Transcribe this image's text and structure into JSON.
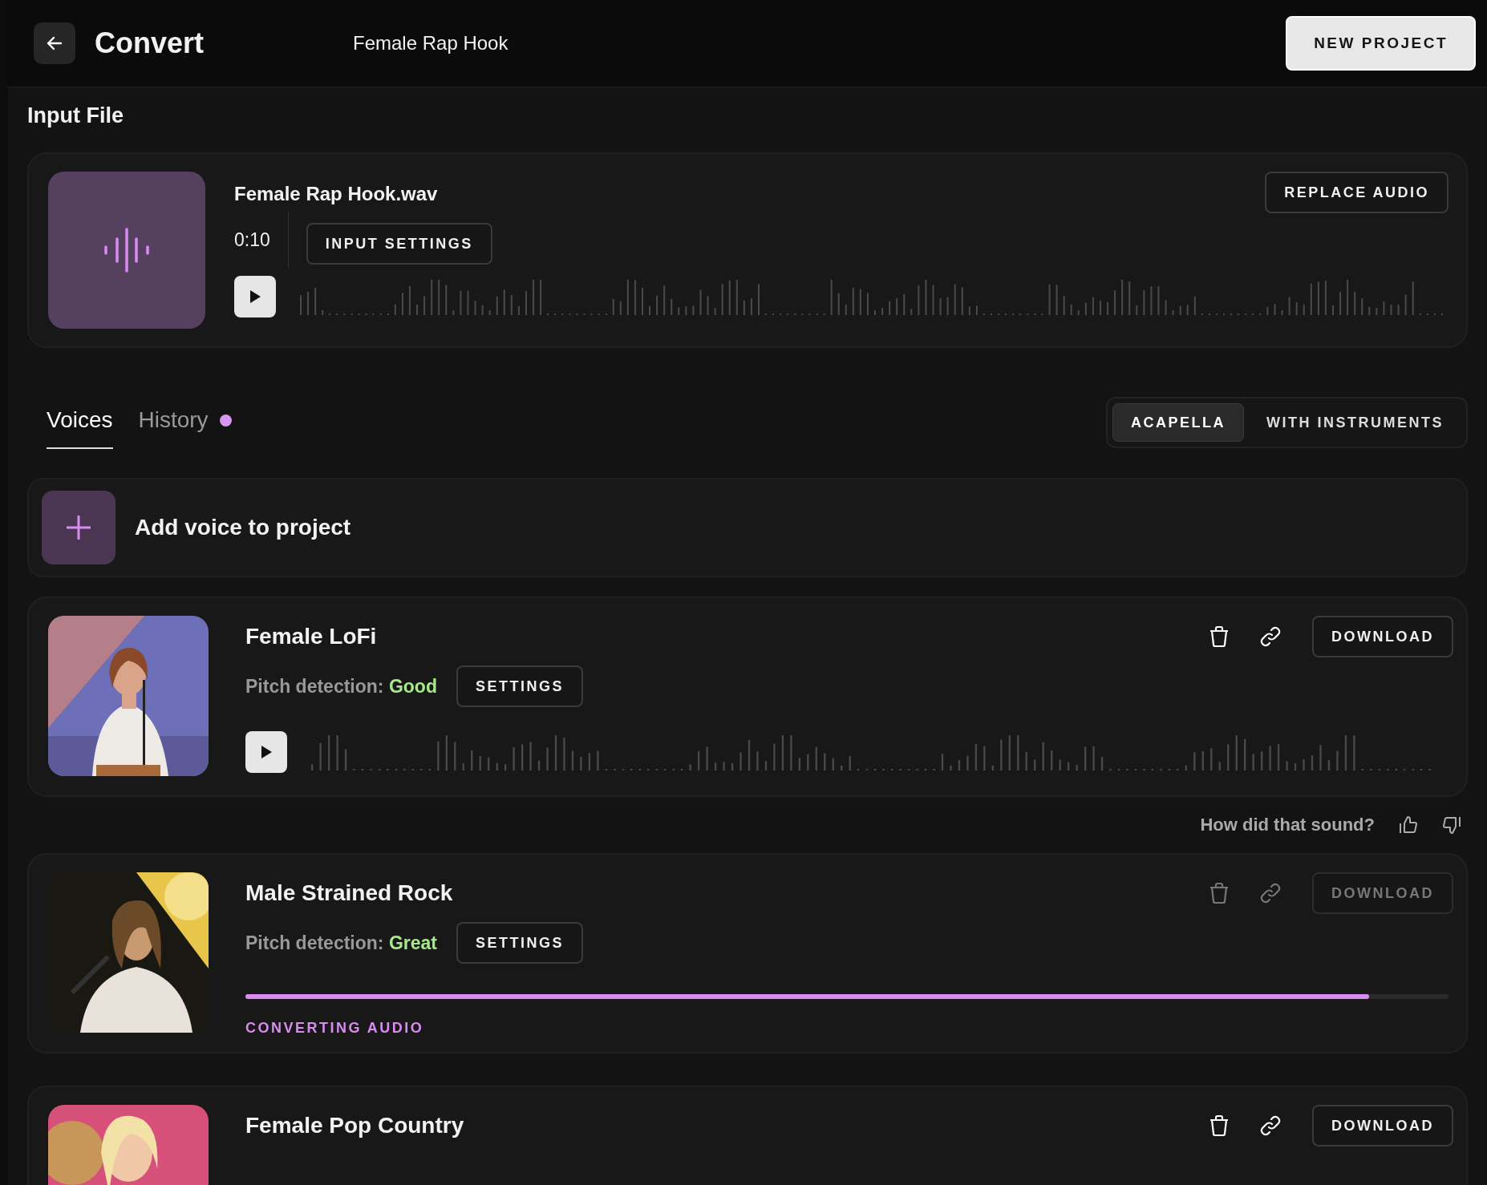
{
  "header": {
    "title": "Convert",
    "project_name": "Female Rap Hook",
    "new_project_button": "NEW PROJECT"
  },
  "input_file": {
    "heading": "Input File",
    "file_name": "Female Rap Hook.wav",
    "duration": "0:10",
    "settings_button": "INPUT SETTINGS",
    "replace_button": "REPLACE AUDIO"
  },
  "tabs": [
    {
      "label": "Voices",
      "selected": true,
      "notification": false
    },
    {
      "label": "History",
      "selected": false,
      "notification": true
    }
  ],
  "mode_toggle": [
    {
      "label": "ACAPELLA",
      "selected": true
    },
    {
      "label": "WITH INSTRUMENTS",
      "selected": false
    }
  ],
  "add_voice": {
    "label": "Add voice to project"
  },
  "voices": [
    {
      "name": "Female LoFi",
      "kind": "player",
      "pitch_label": "Pitch detection:",
      "pitch_value": "Good",
      "settings_button": "SETTINGS",
      "download_button": "DOWNLOAD",
      "disabled": false,
      "feedback": "How did that sound?"
    },
    {
      "name": "Male Strained Rock",
      "kind": "converting",
      "pitch_label": "Pitch detection:",
      "pitch_value": "Great",
      "settings_button": "SETTINGS",
      "download_button": "DOWNLOAD",
      "disabled": true,
      "level": 0.934,
      "status": "CONVERTING AUDIO"
    },
    {
      "name": "Female Pop Country",
      "download_button": "DOWNLOAD",
      "disabled": false
    }
  ]
}
